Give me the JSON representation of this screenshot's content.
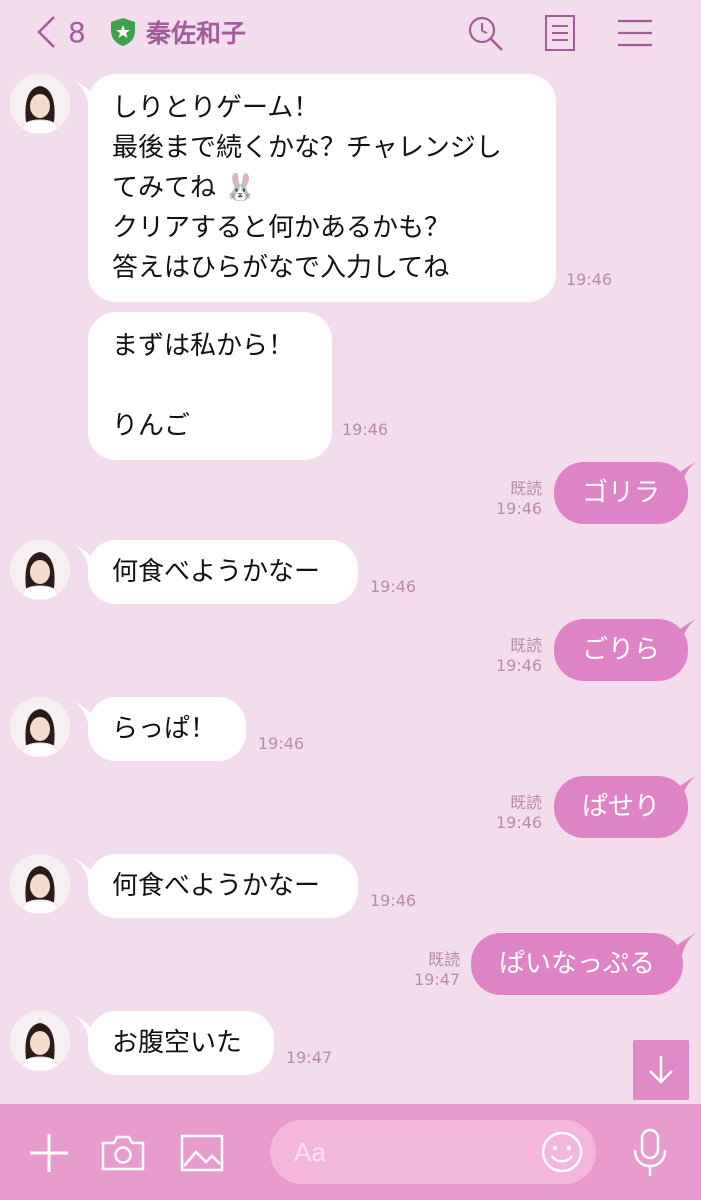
{
  "header": {
    "back_count": "8",
    "title": "秦佐和子"
  },
  "messages": [
    {
      "text": "しりとりゲーム！\n最後まで続くかな？チャレンジし\nてみてね 🐰\nクリアすると何かあるかも？\n答えはひらがなで入力してね",
      "time": "19:46"
    },
    {
      "text": "まずは私から！\n\nりんご",
      "time": "19:46"
    },
    {
      "text": "ゴリラ",
      "read": "既読",
      "time": "19:46"
    },
    {
      "text": "何食べようかなー",
      "time": "19:46"
    },
    {
      "text": "ごりら",
      "read": "既読",
      "time": "19:46"
    },
    {
      "text": "らっぱ！",
      "time": "19:46"
    },
    {
      "text": "ぱせり",
      "read": "既読",
      "time": "19:46"
    },
    {
      "text": "何食べようかなー",
      "time": "19:46"
    },
    {
      "text": "ぱいなっぷる",
      "read": "既読",
      "time": "19:47"
    },
    {
      "text": "お腹空いた",
      "time": "19:47"
    }
  ],
  "input": {
    "placeholder": "Aa"
  },
  "colors": {
    "background": "#f3dcec",
    "accent": "#a35b9d",
    "outgoing_bubble": "#dd83c6",
    "bottom_bar": "#e89bcd"
  },
  "icons": [
    "chevron-left-icon",
    "official-shield-icon",
    "search-icon",
    "notes-icon",
    "menu-icon",
    "arrow-down-icon",
    "plus-icon",
    "camera-icon",
    "image-icon",
    "emoji-icon",
    "mic-icon"
  ]
}
